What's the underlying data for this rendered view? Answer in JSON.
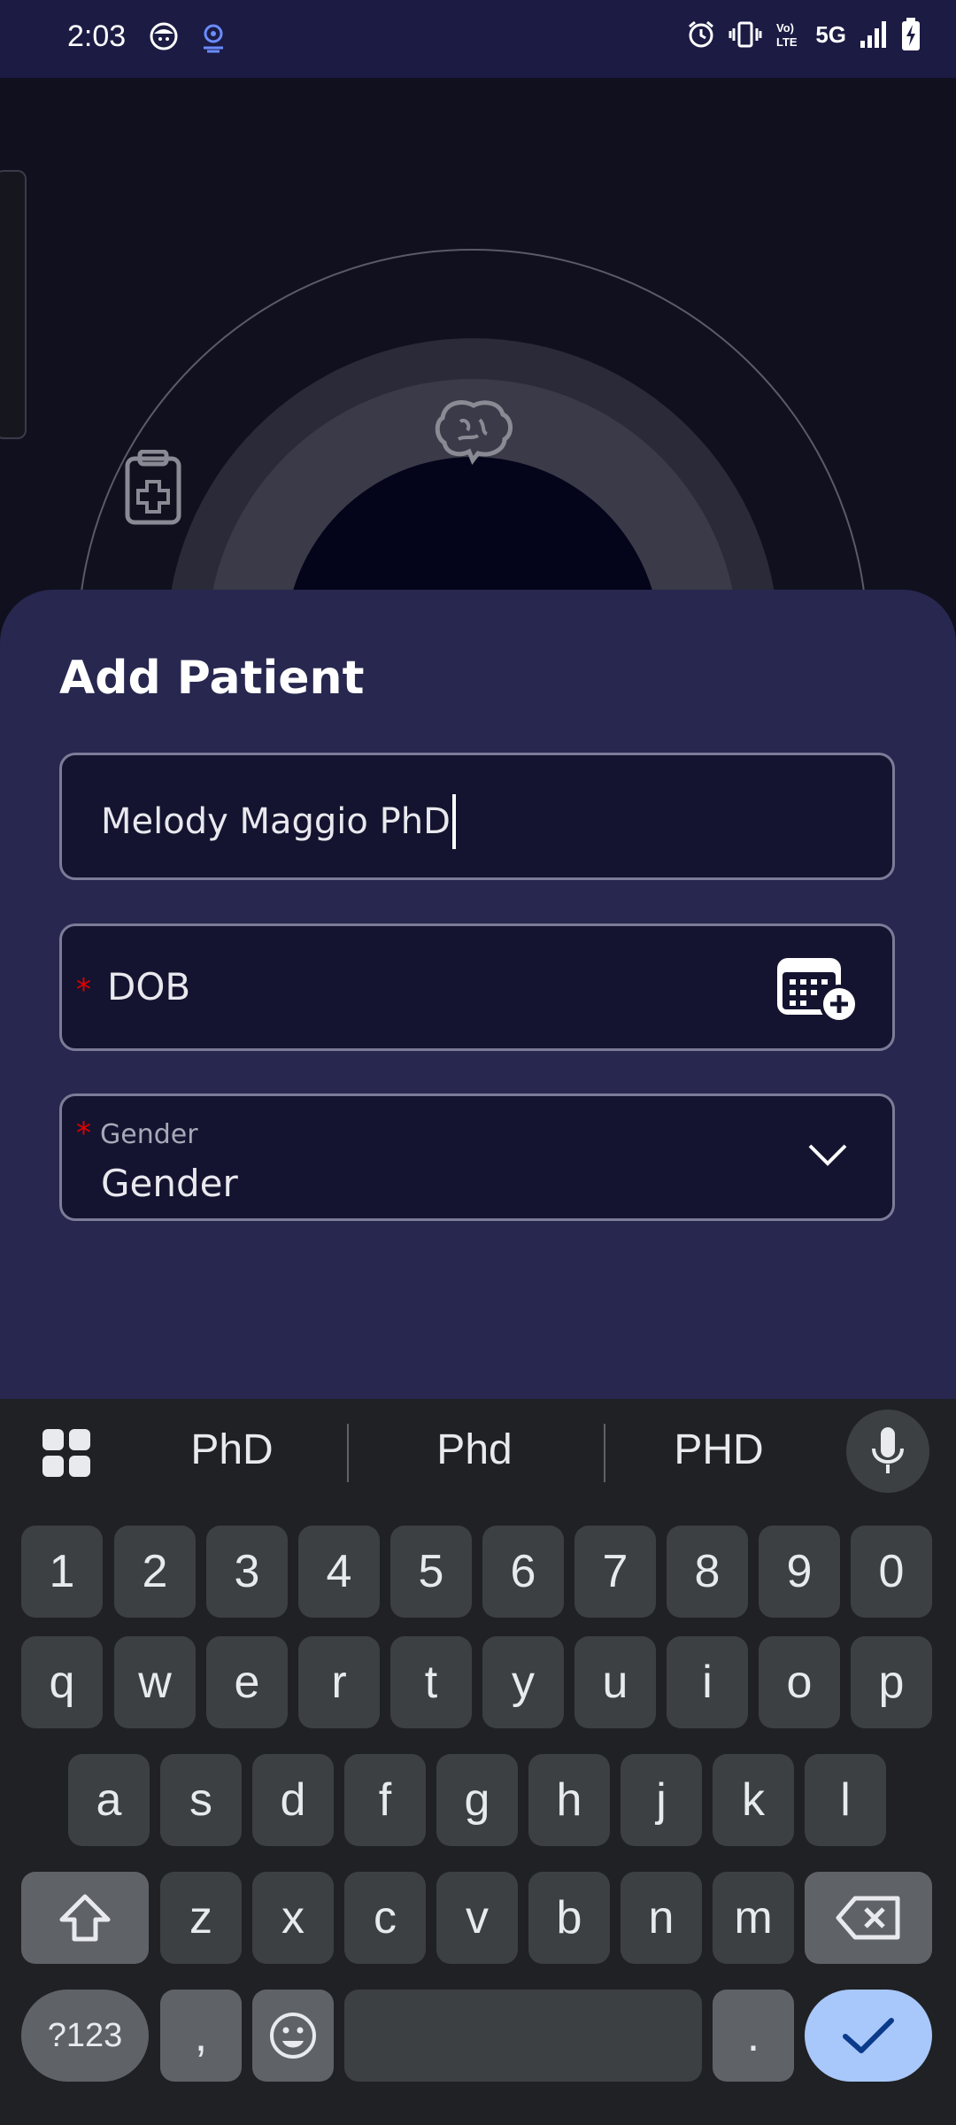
{
  "status_bar": {
    "time": "2:03",
    "network": "5G",
    "icons": [
      "face-icon",
      "location-icon",
      "alarm-icon",
      "vibrate-icon",
      "volte-icon",
      "signal-icon",
      "battery-charging-icon"
    ]
  },
  "background": {
    "icons": [
      "clipboard-medical-icon",
      "brain-icon"
    ]
  },
  "sheet": {
    "title": "Add Patient",
    "name_field": {
      "value": "Melody Maggio PhD"
    },
    "dob_field": {
      "required_mark": "*",
      "label": "DOB"
    },
    "gender_field": {
      "required_mark": "*",
      "floating_label": "Gender",
      "value": "Gender"
    }
  },
  "keyboard": {
    "suggestions": [
      "PhD",
      "Phd",
      "PHD"
    ],
    "number_row": [
      "1",
      "2",
      "3",
      "4",
      "5",
      "6",
      "7",
      "8",
      "9",
      "0"
    ],
    "row1": [
      "q",
      "w",
      "e",
      "r",
      "t",
      "y",
      "u",
      "i",
      "o",
      "p"
    ],
    "row2": [
      "a",
      "s",
      "d",
      "f",
      "g",
      "h",
      "j",
      "k",
      "l"
    ],
    "row3": [
      "z",
      "x",
      "c",
      "v",
      "b",
      "n",
      "m"
    ],
    "symbols_key": "?123",
    "comma_key": ",",
    "period_key": "."
  },
  "colors": {
    "status_bar": "#1b1b44",
    "sheet": "#27274f",
    "field_bg": "#141430",
    "required": "#e00000",
    "keyboard_bg": "#202124",
    "key_bg": "#3c4043",
    "confirm_key": "#a8c7fa"
  }
}
